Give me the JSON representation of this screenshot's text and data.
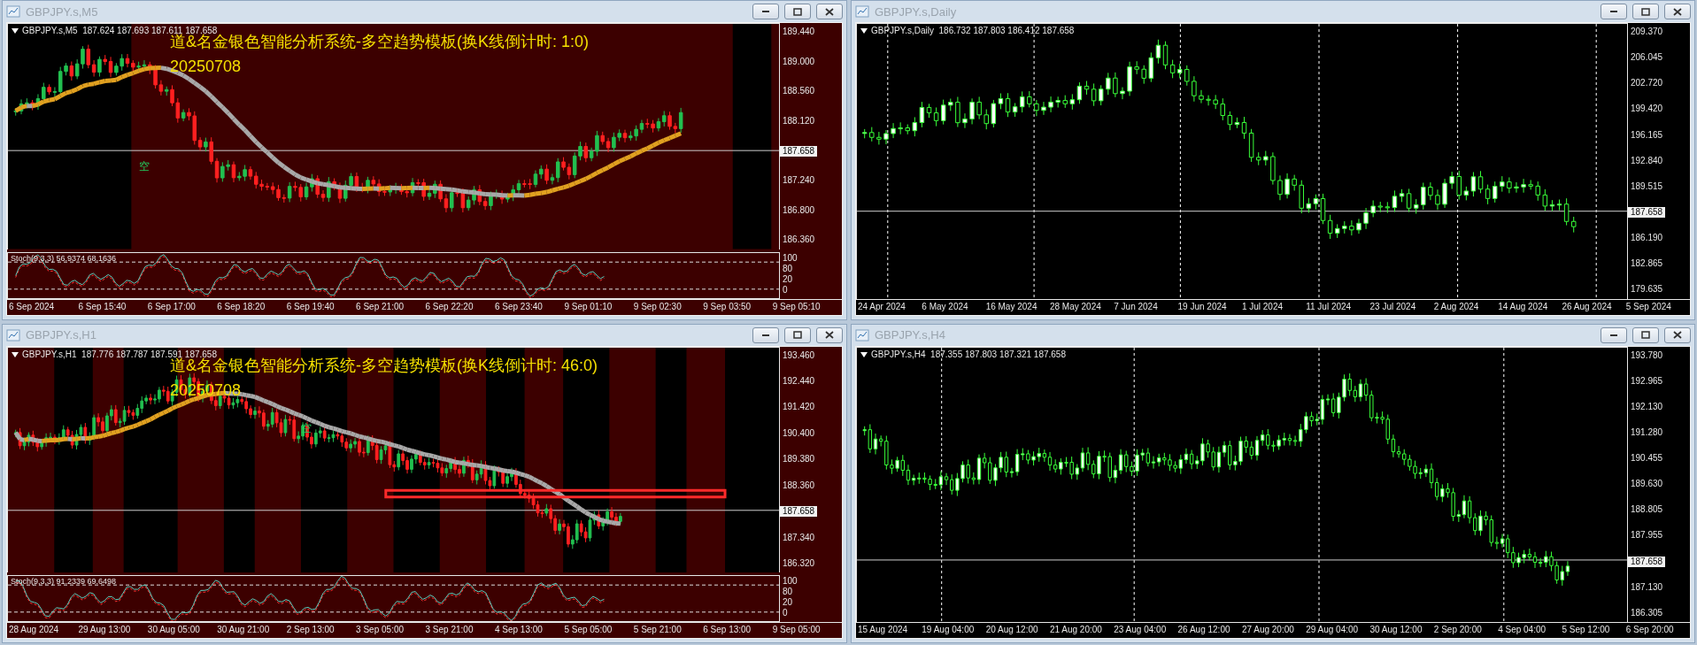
{
  "windows": [
    {
      "title": "GBPJPY.s,M5",
      "kind": "analysis",
      "header": "GBPJPY.s,M5  187.624 187.693 187.611 187.658",
      "overlay_title": "道&名金银色智能分析系统-多空趋势模板(换K线倒计时: 1:0)",
      "overlay_date": "20250708",
      "markers": [
        "空"
      ],
      "price_labels": [
        {
          "text": "189.440",
          "current": false
        },
        {
          "text": "189.000",
          "current": false
        },
        {
          "text": "188.560",
          "current": false
        },
        {
          "text": "188.120",
          "current": false
        },
        {
          "text": "187.658",
          "current": true
        },
        {
          "text": "187.240",
          "current": false
        },
        {
          "text": "186.800",
          "current": false
        },
        {
          "text": "186.360",
          "current": false
        }
      ],
      "indicator": {
        "label": "Stoch(9,3,3) 56.9374 68.1636",
        "levels": [
          "100",
          "80",
          "20",
          "0"
        ]
      },
      "time_labels": [
        "6 Sep 2024",
        "6 Sep 15:40",
        "6 Sep 17:00",
        "6 Sep 18:20",
        "6 Sep 19:40",
        "6 Sep 21:00",
        "6 Sep 22:20",
        "6 Sep 23:40",
        "9 Sep 01:10",
        "9 Sep 02:30",
        "9 Sep 03:50",
        "9 Sep 05:10"
      ]
    },
    {
      "title": "GBPJPY.s,Daily",
      "kind": "plain",
      "header": "GBPJPY.s,Daily  186.732 187.803 186.412 187.658",
      "price_labels": [
        {
          "text": "209.370",
          "current": false
        },
        {
          "text": "206.045",
          "current": false
        },
        {
          "text": "202.720",
          "current": false
        },
        {
          "text": "199.420",
          "current": false
        },
        {
          "text": "196.165",
          "current": false
        },
        {
          "text": "192.840",
          "current": false
        },
        {
          "text": "189.515",
          "current": false
        },
        {
          "text": "187.658",
          "current": true
        },
        {
          "text": "186.190",
          "current": false
        },
        {
          "text": "182.865",
          "current": false
        },
        {
          "text": "179.635",
          "current": false
        }
      ],
      "time_labels": [
        "24 Apr 2024",
        "6 May 2024",
        "16 May 2024",
        "28 May 2024",
        "7 Jun 2024",
        "19 Jun 2024",
        "1 Jul 2024",
        "11 Jul 2024",
        "23 Jul 2024",
        "2 Aug 2024",
        "14 Aug 2024",
        "26 Aug 2024",
        "5 Sep 2024"
      ]
    },
    {
      "title": "GBPJPY.s,H1",
      "kind": "analysis",
      "header": "GBPJPY.s,H1  187.776 187.787 187.591 187.658",
      "overlay_title": "道&名金银色智能分析系统-多空趋势模板(换K线倒计时: 46:0)",
      "overlay_date": "20250708",
      "markers": [
        "空"
      ],
      "price_labels": [
        {
          "text": "193.460",
          "current": false
        },
        {
          "text": "192.440",
          "current": false
        },
        {
          "text": "191.420",
          "current": false
        },
        {
          "text": "190.400",
          "current": false
        },
        {
          "text": "189.380",
          "current": false
        },
        {
          "text": "188.360",
          "current": false
        },
        {
          "text": "187.658",
          "current": true
        },
        {
          "text": "187.340",
          "current": false
        },
        {
          "text": "186.320",
          "current": false
        }
      ],
      "indicator": {
        "label": "Stoch(9,3,3) 91.2339 69.6498",
        "levels": [
          "100",
          "80",
          "20",
          "0"
        ]
      },
      "time_labels": [
        "28 Aug 2024",
        "29 Aug 13:00",
        "30 Aug 05:00",
        "30 Aug 21:00",
        "2 Sep 13:00",
        "3 Sep 05:00",
        "3 Sep 21:00",
        "4 Sep 13:00",
        "5 Sep 05:00",
        "5 Sep 21:00",
        "6 Sep 13:00",
        "9 Sep 05:00"
      ]
    },
    {
      "title": "GBPJPY.s,H4",
      "kind": "plain",
      "header": "GBPJPY.s,H4  187.355 187.803 187.321 187.658",
      "price_labels": [
        {
          "text": "193.780",
          "current": false
        },
        {
          "text": "192.965",
          "current": false
        },
        {
          "text": "192.130",
          "current": false
        },
        {
          "text": "191.280",
          "current": false
        },
        {
          "text": "190.455",
          "current": false
        },
        {
          "text": "189.630",
          "current": false
        },
        {
          "text": "188.805",
          "current": false
        },
        {
          "text": "187.955",
          "current": false
        },
        {
          "text": "187.658",
          "current": true
        },
        {
          "text": "187.130",
          "current": false
        },
        {
          "text": "186.305",
          "current": false
        }
      ],
      "time_labels": [
        "15 Aug 2024",
        "19 Aug 04:00",
        "20 Aug 12:00",
        "21 Aug 20:00",
        "23 Aug 04:00",
        "26 Aug 12:00",
        "27 Aug 20:00",
        "29 Aug 04:00",
        "30 Aug 12:00",
        "2 Sep 20:00",
        "4 Sep 04:00",
        "5 Sep 12:00",
        "6 Sep 20:00"
      ]
    }
  ]
}
